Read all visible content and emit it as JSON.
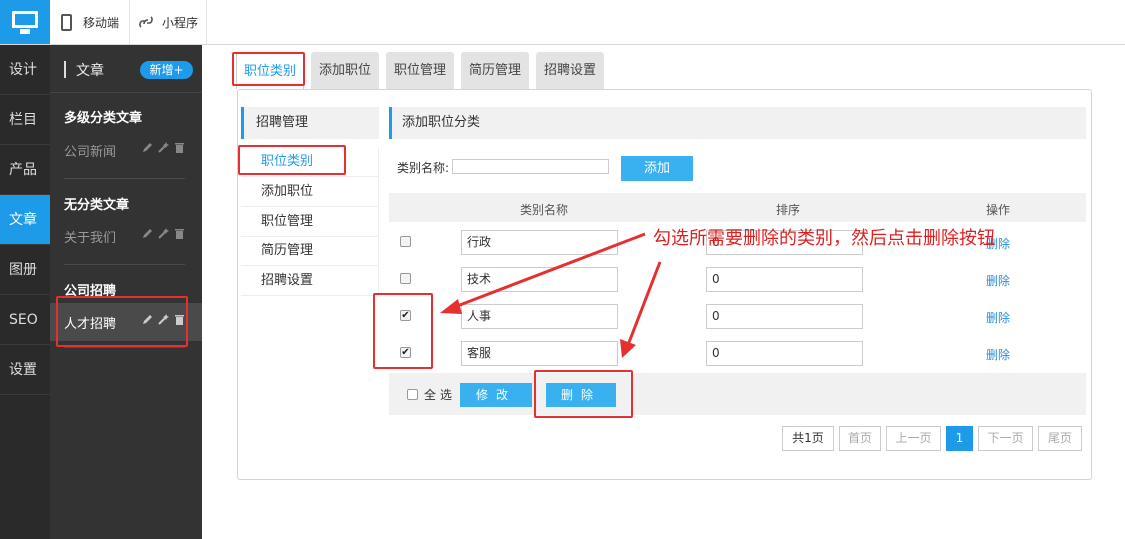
{
  "topbar": {
    "mobile_label": "移动端",
    "mini_label": "小程序"
  },
  "leftnav": [
    {
      "label": "设计",
      "active": false
    },
    {
      "label": "栏目",
      "active": false
    },
    {
      "label": "产品",
      "active": false
    },
    {
      "label": "文章",
      "active": true
    },
    {
      "label": "图册",
      "active": false
    },
    {
      "label": "SEO",
      "active": false
    },
    {
      "label": "设置",
      "active": false
    }
  ],
  "panel2": {
    "title": "文章",
    "add_label": "新增+",
    "group1": "多级分类文章",
    "group1_sub": "公司新闻",
    "group2": "无分类文章",
    "group2_sub": "关于我们",
    "group3": "公司招聘",
    "group3_sub": "人才招聘"
  },
  "tabs": [
    "职位类别",
    "添加职位",
    "职位管理",
    "简历管理",
    "招聘设置"
  ],
  "subside": {
    "header": "招聘管理",
    "items": [
      "职位类别",
      "添加职位",
      "职位管理",
      "简历管理",
      "招聘设置"
    ]
  },
  "right": {
    "header": "添加职位分类",
    "form_label": "类别名称:",
    "add_button": "添加",
    "col_name": "类别名称",
    "col_sort": "排序",
    "col_action": "操作",
    "rows": [
      {
        "name": "行政",
        "sort": "0",
        "action": "删除",
        "checked": false
      },
      {
        "name": "技术",
        "sort": "0",
        "action": "删除",
        "checked": false
      },
      {
        "name": "人事",
        "sort": "0",
        "action": "删除",
        "checked": true
      },
      {
        "name": "客服",
        "sort": "0",
        "action": "删除",
        "checked": true
      }
    ],
    "select_all": "全选",
    "modify_button": "修改",
    "delete_button": "删除"
  },
  "pager": {
    "total": "共1页",
    "first": "首页",
    "prev": "上一页",
    "current": "1",
    "next": "下一页",
    "last": "尾页"
  },
  "annotation": "勾选所需要删除的类别，然后点击删除按钮",
  "colors": {
    "accent": "#1e9be8",
    "button": "#39b0ef",
    "annotation": "#e53030"
  }
}
